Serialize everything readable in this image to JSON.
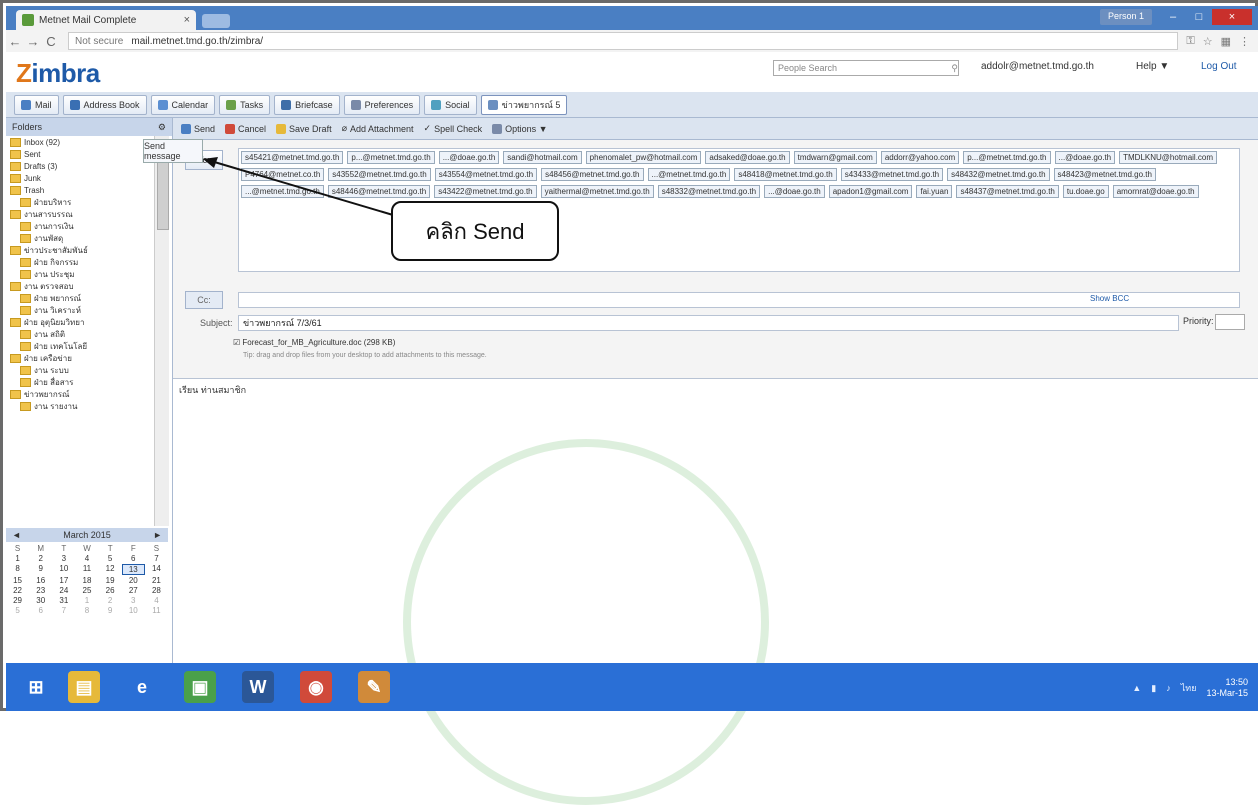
{
  "browser": {
    "tab_title": "Metnet Mail Complete",
    "tab_close": "×",
    "security": "Not secure",
    "url": "mail.metnet.tmd.go.th/zimbra/",
    "user_button": "Person 1",
    "min": "–",
    "max": "□",
    "close": "×",
    "back": "←",
    "forward": "→",
    "reload": "C"
  },
  "header": {
    "logo_z": "Z",
    "logo_rest": "imbra",
    "search_placeholder": "People Search",
    "account": "addolr@metnet.tmd.go.th",
    "help": "Help ▼",
    "logout": "Log Out"
  },
  "apptabs": [
    {
      "label": "Mail",
      "color": "#4a7fc3"
    },
    {
      "label": "Address Book",
      "color": "#3a6fb3"
    },
    {
      "label": "Calendar",
      "color": "#5b8fd2"
    },
    {
      "label": "Tasks",
      "color": "#6aa04a"
    },
    {
      "label": "Briefcase",
      "color": "#3e6ea8"
    },
    {
      "label": "Preferences",
      "color": "#7a8aa8"
    },
    {
      "label": "Social",
      "color": "#4fa0c0"
    },
    {
      "label": "ข่าวพยากรณ์ 5",
      "color": "#6b8fc0"
    }
  ],
  "folders": {
    "header": "Folders",
    "items": [
      "Inbox (92)",
      "Sent",
      "Drafts (3)",
      "Junk",
      "Trash",
      "ฝ่ายบริหาร",
      "งานสารบรรณ",
      "งานการเงิน",
      "งานพัสดุ",
      "ข่าวประชาสัมพันธ์",
      "ฝ่าย กิจกรรม",
      "งาน ประชุม",
      "งาน ตรวจสอบ",
      "ฝ่าย พยากรณ์",
      "งาน วิเคราะห์",
      "ฝ่าย อุตุนิยมวิทยา",
      "งาน สถิติ",
      "ฝ่าย เทคโนโลยี",
      "ฝ่าย เครือข่าย",
      "งาน ระบบ",
      "ฝ่าย สื่อสาร",
      "ข่าวพยากรณ์",
      "งาน รายงาน"
    ]
  },
  "calendar": {
    "month": "March 2015",
    "prev": "◄",
    "next": "►",
    "dow": [
      "S",
      "M",
      "T",
      "W",
      "T",
      "F",
      "S"
    ],
    "days": [
      "1",
      "2",
      "3",
      "4",
      "5",
      "6",
      "7",
      "8",
      "9",
      "10",
      "11",
      "12",
      "13",
      "14",
      "15",
      "16",
      "17",
      "18",
      "19",
      "20",
      "21",
      "22",
      "23",
      "24",
      "25",
      "26",
      "27",
      "28",
      "29",
      "30",
      "31",
      "1",
      "2",
      "3",
      "4",
      "5",
      "6",
      "7",
      "8",
      "9",
      "10",
      "11"
    ]
  },
  "compose_toolbar": {
    "send": "Send",
    "cancel": "Cancel",
    "save_draft": "Save Draft",
    "add_attachment": "Add Attachment",
    "spell_check": "Spell Check",
    "options": "Options ▼"
  },
  "tooltip": "Send message",
  "compose": {
    "to_button": "To:",
    "cc_button": "Cc:",
    "show_bcc": "Show BCC",
    "subject_label": "Subject:",
    "subject": "ข่าวพยากรณ์ 7/3/61",
    "priority_label": "Priority:",
    "attachment": "Forecast_for_MB_Agriculture.doc (298 KB)",
    "attachment_hint": "Tip: drag and drop files from your desktop to add attachments to this message.",
    "body": "เรียน ท่านสมาชิก"
  },
  "recipients": [
    "s45421@metnet.tmd.go.th",
    "p...@metnet.tmd.go.th",
    "...@doae.go.th",
    "sandi@hotmail.com",
    "phenomalet_pw@hotmail.com",
    "adsaked@doae.go.th",
    "tmdwarn@gmail.com",
    "addorr@yahoo.com",
    "p...@metnet.tmd.go.th",
    "...@doae.go.th",
    "TMDLKNU@hotmail.com",
    "P4764@metnet.co.th",
    "s43552@metnet.tmd.go.th",
    "s43554@metnet.tmd.go.th",
    "s48456@metnet.tmd.go.th",
    "...@metnet.tmd.go.th",
    "s48418@metnet.tmd.go.th",
    "s43433@metnet.tmd.go.th",
    "s48432@metnet.tmd.go.th",
    "s48423@metnet.tmd.go.th",
    "...@metnet.tmd.go.th",
    "s48446@metnet.tmd.go.th",
    "s43422@metnet.tmd.go.th",
    "yaithermal@metnet.tmd.go.th",
    "s48332@metnet.tmd.go.th",
    "...@doae.go.th",
    "apadon1@gmail.com",
    "fai.yuan",
    "s48437@metnet.tmd.go.th",
    "tu.doae.go",
    "amornrat@doae.go.th"
  ],
  "callout": "คลิก Send",
  "taskbar": {
    "icons": [
      {
        "name": "start",
        "glyph": "⊞",
        "color": "#2a6fd6"
      },
      {
        "name": "explorer",
        "glyph": "▤",
        "color": "#e6b93a"
      },
      {
        "name": "ie",
        "glyph": "e",
        "color": "#2a6fd6"
      },
      {
        "name": "app",
        "glyph": "▣",
        "color": "#4aa04a"
      },
      {
        "name": "word",
        "glyph": "W",
        "color": "#2b5797"
      },
      {
        "name": "chrome",
        "glyph": "◉",
        "color": "#d04a3a"
      },
      {
        "name": "paint",
        "glyph": "✎",
        "color": "#d08a3a"
      }
    ],
    "lang": "ไทย",
    "time": "13:50",
    "date": "13-Mar-15"
  }
}
